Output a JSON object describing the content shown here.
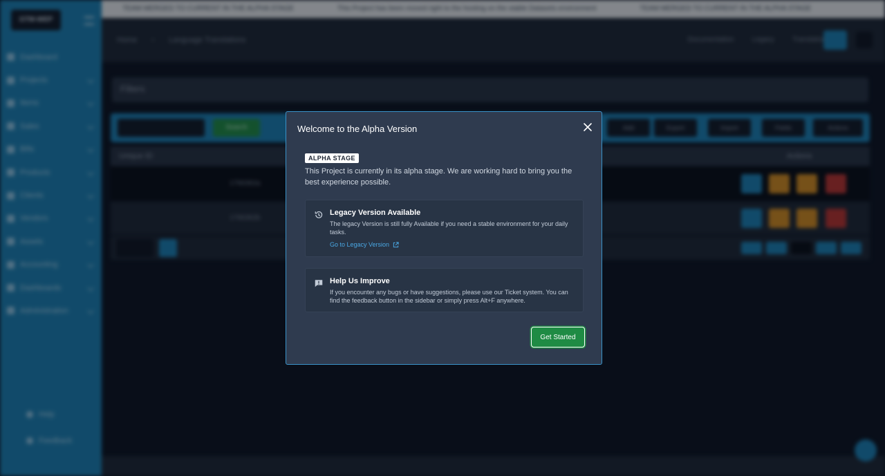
{
  "background": {
    "logo": "GTM-WEP",
    "topstrip": [
      "TEAM MERGED TO CURRENT IN THE ALPHA STAGE",
      "This Project has been moved right to the hosting on the stable Datasets environment",
      "TEAM MERGED TO CURRENT IN THE ALPHA STAGE"
    ],
    "breadcrumb": [
      "Home",
      "Language Translations"
    ],
    "top_links": [
      "Documentation",
      "Legacy",
      "Translations"
    ],
    "sidebar_items": [
      "Dashboard",
      "Projects",
      "Items",
      "Sales",
      "Bills",
      "Products",
      "Clients",
      "Vendors",
      "Assets",
      "Accounting",
      "Dashboards",
      "Administration"
    ],
    "sidebar_bottom": [
      "Help",
      "Feedback"
    ],
    "filters_label": "Filters",
    "search_label": "Search",
    "toolbar_buttons": [
      "Add",
      "Export",
      "Import",
      "Fields",
      "Actions"
    ],
    "table_headers": [
      "Unique ID",
      "Actions"
    ],
    "rows": [
      "1766362a",
      "1766362b"
    ],
    "colors": {
      "sidebar": "#1b7fb3",
      "green": "#1f8b44",
      "orange": "#d28a1f",
      "red": "#b8322f"
    }
  },
  "modal": {
    "title": "Welcome to the Alpha Version",
    "badge": "ALPHA STAGE",
    "intro": "This Project is currently in its alpha stage. We are working hard to bring you the best experience possible.",
    "legacy": {
      "icon": "history-icon",
      "title": "Legacy Version Available",
      "text": "The legacy Version is still fully Available if you need a stable environment for your daily tasks.",
      "link": "Go to Legacy Version",
      "link_icon": "external-link-icon"
    },
    "improve": {
      "icon": "feedback-icon",
      "title": "Help Us Improve",
      "text": "If you encounter any bugs or have suggestions, please use our Ticket system. You can find the feedback button in the sidebar or simply press Alt+F anywhere."
    },
    "button": "Get Started",
    "colors": {
      "background": "#2f3b4f",
      "border": "#3a93c9",
      "link": "#4aa7e3",
      "button": "#1f8b44"
    }
  }
}
